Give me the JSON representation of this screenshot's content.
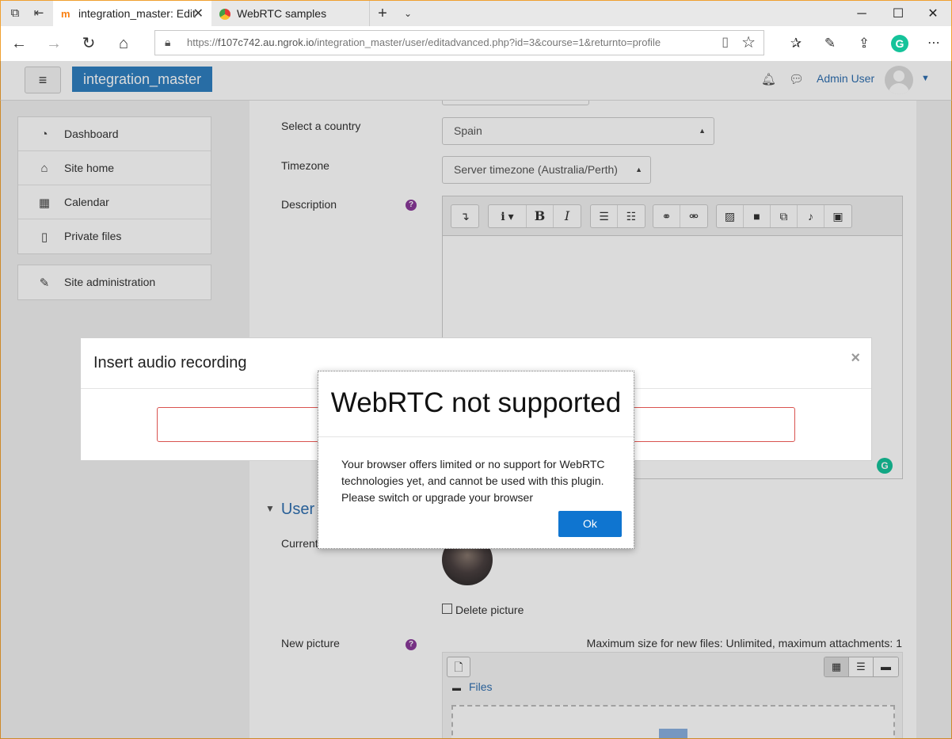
{
  "browser": {
    "tabs": [
      {
        "title": "integration_master: Edit",
        "active": true
      },
      {
        "title": "WebRTC samples",
        "active": false
      }
    ],
    "url_prefix": "https://",
    "url_host": "f107c742.au.ngrok.io",
    "url_path": "/integration_master/user/editadvanced.php?id=3&course=1&returnto=profile"
  },
  "header": {
    "brand": "integration_master",
    "username": "Admin User"
  },
  "sidebar": {
    "items": [
      {
        "label": "Dashboard",
        "icon": "dashboard-icon",
        "glyph": "◔"
      },
      {
        "label": "Site home",
        "icon": "home-icon",
        "glyph": "⌂"
      },
      {
        "label": "Calendar",
        "icon": "calendar-icon",
        "glyph": "▦"
      },
      {
        "label": "Private files",
        "icon": "file-icon",
        "glyph": "▯"
      }
    ],
    "admin": {
      "label": "Site administration",
      "icon": "wrench-icon",
      "glyph": "✎"
    }
  },
  "form": {
    "country_label": "Select a country",
    "country_value": "Spain",
    "timezone_label": "Timezone",
    "timezone_value": "Server timezone (Australia/Perth)",
    "description_label": "Description",
    "section_title": "User",
    "current_picture_label": "Current",
    "delete_picture_label": "Delete picture",
    "new_picture_label": "New picture",
    "max_size_text": "Maximum size for new files: Unlimited, maximum attachments: 1",
    "files_label": "Files"
  },
  "audio_dialog": {
    "title": "Insert audio recording"
  },
  "alert": {
    "title": "WebRTC not supported",
    "message": "Your browser offers limited or no support for WebRTC technologies yet, and cannot be used with this plugin. Please switch or upgrade your browser",
    "ok_label": "Ok"
  },
  "colors": {
    "brand": "#2f7fc1",
    "link": "#2f6fb0",
    "ok_button": "#0f75d0",
    "help": "#8a3a9a",
    "error_border": "#d9534f"
  }
}
